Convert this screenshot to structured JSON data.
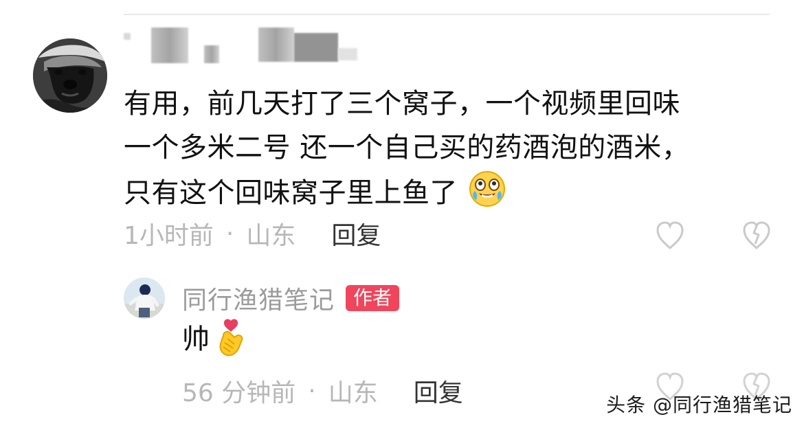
{
  "comment": {
    "lines": [
      "有用，前几天打了三个窝子，一个视频里回味",
      "一个多米二号  还一个自己买的药酒泡的酒米，",
      "只有这个回味窝子里上鱼了"
    ],
    "meta": {
      "time": "1小时前",
      "separator": "·",
      "location": "山东",
      "reply_label": "回复"
    },
    "icons": {
      "avatar": "honey-badger-avatar",
      "emoji": "laugh-cry-emoji",
      "like": "heart-outline-icon",
      "dislike": "broken-heart-icon"
    }
  },
  "reply": {
    "author": "同行渔猎笔记",
    "badge": "作者",
    "text": "帅",
    "meta": {
      "time": "56 分钟前",
      "separator": "·",
      "location": "山东",
      "reply_label": "回复"
    },
    "icons": {
      "avatar": "person-avatar",
      "emoji": "heart-hand-emoji",
      "like": "heart-outline-icon",
      "dislike": "broken-heart-icon"
    }
  },
  "watermark": {
    "text": "头条 @同行渔猎笔记"
  },
  "colors": {
    "badge": "#f1455b",
    "meta_text": "#b7b7b7",
    "body_text": "#111111",
    "reply_author": "#9b9b9b"
  }
}
